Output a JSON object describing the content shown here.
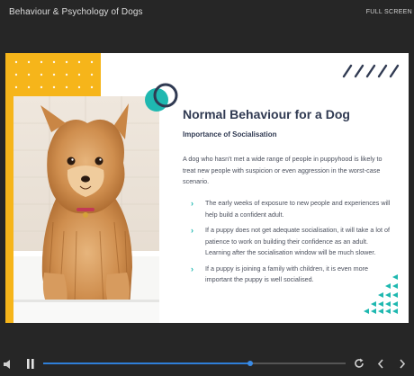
{
  "header": {
    "course_title": "Behaviour & Psychology of Dogs",
    "fullscreen_label": "FULL SCREEN"
  },
  "slide": {
    "title": "Normal Behaviour for a Dog",
    "subheading": "Importance of Socialisation",
    "intro": "A dog who hasn't met a wide range of people in puppyhood is likely to treat new people with suspicion or even aggression in the worst-case scenario.",
    "bullets": [
      "The early weeks of exposure to new people and experiences will help build a confident adult.",
      "If a puppy does not get adequate socialisation, it will take a lot of patience to work on building their confidence as an adult. Learning after the socialisation window will be much slower.",
      "If a puppy is joining a family with children, it is even more important the puppy is well socialised."
    ],
    "bullet_marker": "›"
  },
  "player": {
    "progress": 0.685,
    "icons": [
      "volume-icon",
      "pause-icon",
      "replay-icon",
      "previous-icon",
      "next-icon"
    ]
  },
  "colors": {
    "background": "#262626",
    "accent_yellow": "#f6b51a",
    "accent_teal": "#1fb8b0",
    "title_navy": "#303a52",
    "progress_blue": "#2f7fd8"
  }
}
